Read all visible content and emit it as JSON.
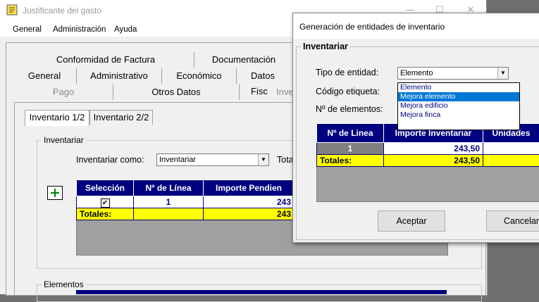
{
  "main": {
    "title": "Justificante del gasto",
    "menu": [
      "General",
      "Administración",
      "Ayuda"
    ],
    "tabs_row1": [
      "Conformidad de Factura",
      "Documentación"
    ],
    "tabs_row2": [
      "General",
      "Administrativo",
      "Económico",
      "Datos Fisc"
    ],
    "tabs_row3": [
      "Pago",
      "Otros Datos",
      "Inve"
    ],
    "subtabs": [
      "Inventario 1/2",
      "Inventario 2/2"
    ],
    "inventariar_legend": "Inventariar",
    "inventariar_como_label": "Inventariar como:",
    "inventariar_como_value": "Inventariar",
    "tota_label": "Tota",
    "add_button": "+",
    "grid": {
      "headers": [
        "Selección",
        "Nº de Línea",
        "Importe Pendien"
      ],
      "row": {
        "check": "✔",
        "linea": "1",
        "importe": "243"
      },
      "totals_label": "Totales:",
      "totals_value": "243"
    },
    "elementos_legend": "Elementos"
  },
  "dialog": {
    "title": "Generación de entidades de inventario",
    "frame_legend": "Inventariar",
    "tipo_label": "Tipo de entidad:",
    "tipo_value": "Elemento",
    "codigo_label": "Código etiqueta:",
    "num_label": "Nº de elementos:",
    "dropdown_options": [
      "Elemento",
      "Mejora elemento",
      "Mejora edificio",
      "Mejora finca"
    ],
    "grid": {
      "headers": [
        "Nº de Linea",
        "Importe Inventariar",
        "Unidades"
      ],
      "row": {
        "linea": "1",
        "importe": "243,50",
        "unidades": ""
      },
      "totals_label": "Totales:",
      "totals_value": "243,50"
    },
    "aceptar": "Aceptar",
    "cancelar": "Cancelar"
  }
}
